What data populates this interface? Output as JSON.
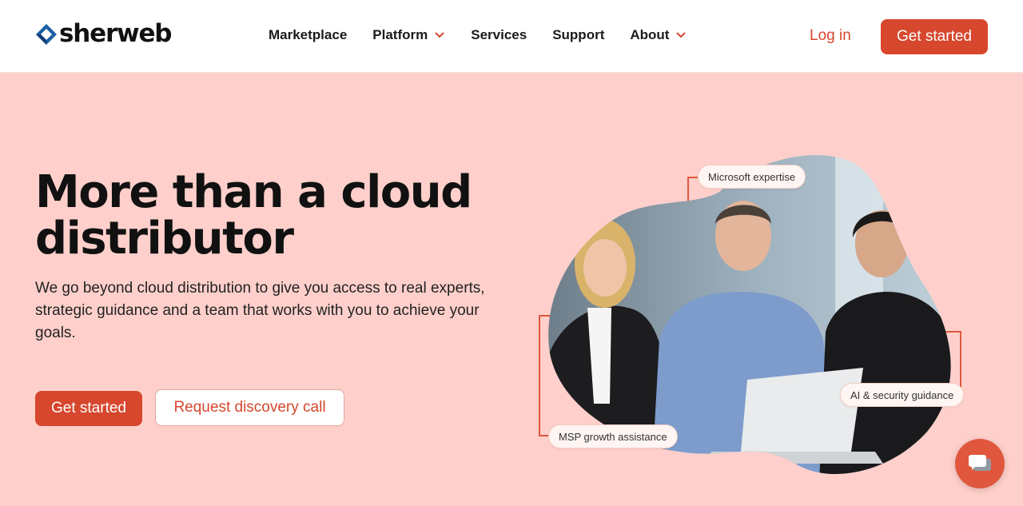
{
  "brand": {
    "logo_text": "sherweb",
    "accent": "#d6472d",
    "logo_blue": "#1b5fa6"
  },
  "nav": {
    "items": [
      {
        "label": "Marketplace",
        "has_dropdown": false
      },
      {
        "label": "Platform",
        "has_dropdown": true
      },
      {
        "label": "Services",
        "has_dropdown": false
      },
      {
        "label": "Support",
        "has_dropdown": false
      },
      {
        "label": "About",
        "has_dropdown": true
      }
    ],
    "login_label": "Log in",
    "cta_label": "Get started"
  },
  "hero": {
    "title_line1": "More than a cloud",
    "title_line2": "distributor",
    "subtitle": "We go beyond cloud distribution to give you access to real experts, strategic guidance and a team that works with you to achieve your goals.",
    "primary_cta": "Get started",
    "secondary_cta": "Request discovery call"
  },
  "visual": {
    "tags": {
      "microsoft": "Microsoft expertise",
      "ai_security": "AI & security guidance",
      "msp_growth": "MSP growth assistance"
    }
  },
  "chat": {
    "icon": "chat-bubbles-icon"
  }
}
